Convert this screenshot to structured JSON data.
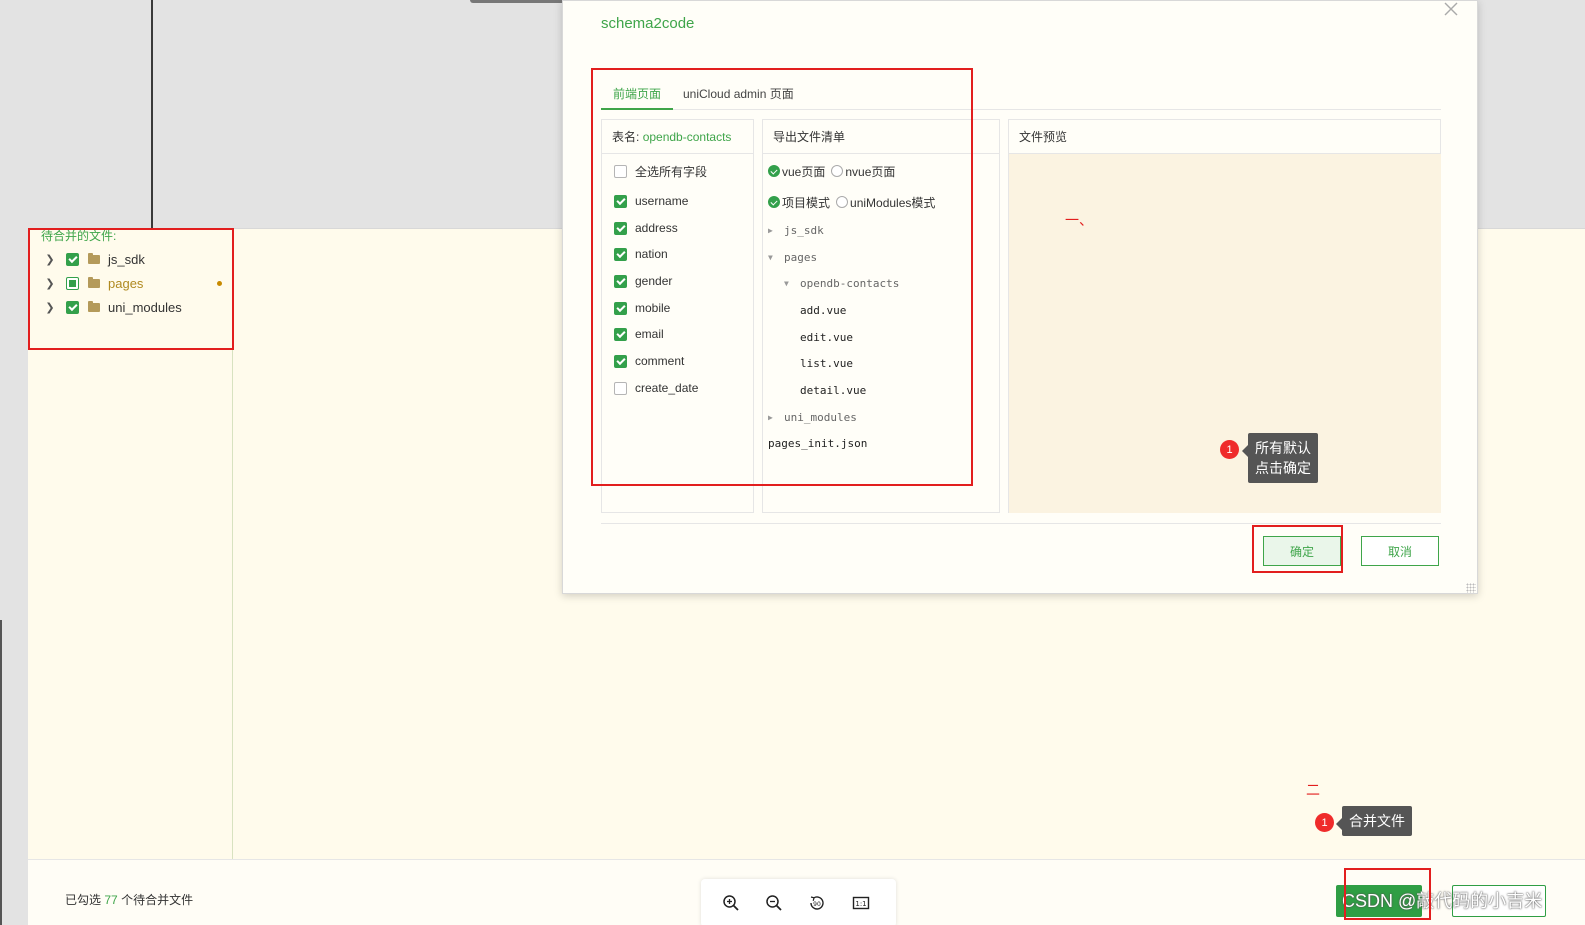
{
  "dialog": {
    "title": "schema2code",
    "tabs": [
      {
        "label": "前端页面",
        "active": true
      },
      {
        "label": "uniCloud admin 页面",
        "active": false
      }
    ],
    "fields_panel": {
      "table_prefix": "表名:",
      "table_name": "opendb-contacts",
      "select_all_label": "全选所有字段",
      "select_all_checked": false,
      "fields": [
        {
          "name": "username",
          "checked": true
        },
        {
          "name": "address",
          "checked": true
        },
        {
          "name": "nation",
          "checked": true
        },
        {
          "name": "gender",
          "checked": true
        },
        {
          "name": "mobile",
          "checked": true
        },
        {
          "name": "email",
          "checked": true
        },
        {
          "name": "comment",
          "checked": true
        },
        {
          "name": "create_date",
          "checked": false
        }
      ]
    },
    "export_panel": {
      "header": "导出文件清单",
      "page_type": {
        "options": [
          "vue页面",
          "nvue页面"
        ],
        "selected": "vue页面"
      },
      "mode": {
        "options": [
          "项目模式",
          "uniModules模式"
        ],
        "selected": "项目模式"
      },
      "files": [
        {
          "name": "js_sdk",
          "type": "folder",
          "expanded": false,
          "depth": 0
        },
        {
          "name": "pages",
          "type": "folder",
          "expanded": true,
          "depth": 0
        },
        {
          "name": "opendb-contacts",
          "type": "folder",
          "expanded": true,
          "depth": 1
        },
        {
          "name": "add.vue",
          "type": "file",
          "depth": 2
        },
        {
          "name": "edit.vue",
          "type": "file",
          "depth": 2
        },
        {
          "name": "list.vue",
          "type": "file",
          "depth": 2
        },
        {
          "name": "detail.vue",
          "type": "file",
          "depth": 2
        },
        {
          "name": "uni_modules",
          "type": "folder",
          "expanded": false,
          "depth": 0
        },
        {
          "name": "pages_init.json",
          "type": "file",
          "depth": 0
        }
      ]
    },
    "preview_panel": {
      "header": "文件预览"
    },
    "ok_label": "确定",
    "cancel_label": "取消"
  },
  "merge": {
    "title": "待合并的文件:",
    "tree": [
      {
        "name": "js_sdk",
        "check": "checked",
        "modified": false
      },
      {
        "name": "pages",
        "check": "partial",
        "modified": true
      },
      {
        "name": "uni_modules",
        "check": "checked",
        "modified": false
      }
    ],
    "footer": {
      "selected_prefix": "已勾选",
      "selected_count": "77",
      "selected_suffix": "个待合并文件",
      "zoom_icons": [
        "zoom-in-icon",
        "zoom-out-icon",
        "rotate-90-icon",
        "actual-size-icon"
      ]
    }
  },
  "annotations": {
    "mark_one": "一、",
    "mark_two": "二",
    "badge_number": "1",
    "tip_confirm_line1": "所有默认",
    "tip_confirm_line2": "点击确定",
    "tip_merge": "合并文件"
  },
  "watermark": "CSDN @敲代码的小吉米",
  "colors": {
    "accent": "#3fa54a",
    "annotation_red": "#e21e1e",
    "preview_bg": "#fbf3e1",
    "panel_bg": "#fffbec"
  }
}
